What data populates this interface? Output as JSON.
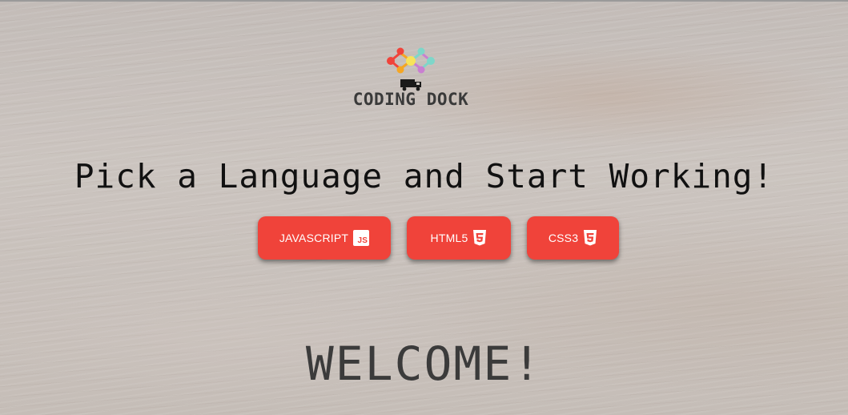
{
  "brand": {
    "name": "CODING DOCK",
    "logo_icon": "molecule-network-with-truck-icon"
  },
  "headline": "Pick a Language and Start Working!",
  "languages": [
    {
      "label": "JAVASCRIPT",
      "icon": "js-icon",
      "icon_text": "JS"
    },
    {
      "label": "HTML5",
      "icon": "html5-icon"
    },
    {
      "label": "CSS3",
      "icon": "css3-icon"
    }
  ],
  "welcome": "WELCOME!",
  "colors": {
    "button": "#f0433a",
    "button_text": "#ffffff",
    "headline_text": "#111111",
    "welcome_text": "#3b3b3b",
    "logo_text": "#3a3a3a",
    "logo_dots": [
      "#f0433a",
      "#f5a623",
      "#7ed6c9",
      "#c97fd1",
      "#f7e35a"
    ]
  }
}
